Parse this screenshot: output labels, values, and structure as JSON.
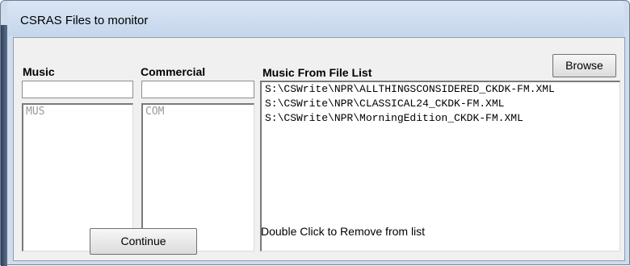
{
  "window": {
    "title": "CSRAS Files to monitor"
  },
  "music": {
    "label": "Music",
    "input_value": "",
    "list_items": [
      "MUS"
    ]
  },
  "commercial": {
    "label": "Commercial",
    "input_value": "",
    "list_items": [
      "COM"
    ]
  },
  "file_list": {
    "label": "Music From File List",
    "items": [
      "S:\\CSWrite\\NPR\\ALLTHINGSCONSIDERED_CKDK-FM.XML",
      "S:\\CSWrite\\NPR\\CLASSICAL24_CKDK-FM.XML",
      "S:\\CSWrite\\NPR\\MorningEdition_CKDK-FM.XML"
    ]
  },
  "buttons": {
    "browse": "Browse",
    "continue": "Continue"
  },
  "hint": "Double Click to Remove from list"
}
